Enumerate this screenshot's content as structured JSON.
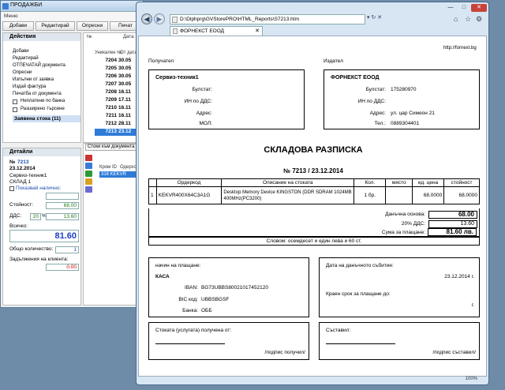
{
  "sales": {
    "title": "ПРОДАЖБИ",
    "menu": "Меню",
    "toolbar": [
      "Добави",
      "Редактирай",
      "Опресни",
      "Печат"
    ],
    "actions_header": "Действия",
    "actions": [
      "Добави",
      "Редактирай",
      "ОТПЕЧАТАЙ документа",
      "Опресни",
      "Изпълни от заявка",
      "Издай фактура",
      "Печатба от документа"
    ],
    "checkboxes": [
      "Неплатени по банка",
      "Разширено търсене"
    ],
    "selected_action": "Заявена стока (11)",
    "filter_labels": {
      "no": "№",
      "date": "Дата:"
    },
    "grid_headers": [
      "Уникален №",
      "От дата"
    ],
    "grid_rows": [
      {
        "id": "7204",
        "date": "30.05"
      },
      {
        "id": "7205",
        "date": "30.05"
      },
      {
        "id": "7206",
        "date": "30.05"
      },
      {
        "id": "7207",
        "date": "30.05"
      },
      {
        "id": "7208",
        "date": "16.11"
      },
      {
        "id": "7209",
        "date": "17.11"
      },
      {
        "id": "7210",
        "date": "16.11"
      },
      {
        "id": "7211",
        "date": "16.11"
      },
      {
        "id": "7212",
        "date": "28.11"
      },
      {
        "id": "7213",
        "date": "23.12"
      }
    ],
    "details_header": "Детайли",
    "details": {
      "no_label": "№",
      "no": "7213",
      "date": "23.12.2014",
      "client": "Сервиз-техник1",
      "warehouse": "СКЛАД 1",
      "cash_label": "Показвай налично:",
      "value_label": "Стойност:",
      "value": "68.00",
      "vat_label": "ДДС:",
      "vat_percent": "20",
      "vat_percent_sign": "%",
      "vat_value": "13.60",
      "total_label": "Всичко:",
      "total": "81.60",
      "qty_label": "Общо количество:",
      "qty": "1",
      "debt_label": "Задължения на клиента:",
      "debt": "0.00"
    },
    "items_tab": "Стоки към документа",
    "items_headers": [
      "Кром ID",
      "Одерхо"
    ],
    "items_row": "316  KEKVR"
  },
  "browser": {
    "address": "D:\\Dlphprg\\GVStorePRO\\HTML_Reports\\S7213.htm",
    "tab_title": "ФОРНЕКСТ ЕООД",
    "status_zoom": "100%",
    "nav_back": "◀",
    "nav_forward": "▶",
    "addr_tools": "▾ ↻ ✕",
    "tab_close": "✕",
    "caption_buttons": [
      "—",
      "□",
      "✕"
    ],
    "ie_icons": [
      "⌂",
      "☆",
      "⚙"
    ]
  },
  "doc": {
    "website": "http://fornext.bg",
    "recipient_caption": "Получател",
    "issuer_caption": "Издател",
    "recipient": {
      "name": "Сервиз-техник1",
      "bulstat_label": "Булстат:",
      "vat_label": "ИН по ДДС:",
      "address_label": "Адрес:",
      "mol_label": "МОЛ:"
    },
    "issuer": {
      "name": "ФОРНЕКСТ ЕООД",
      "bulstat_label": "Булстат:",
      "bulstat": "175280970",
      "vat_label": "ИН по ДДС:",
      "address_label": "Адрес:",
      "address": "ул. цар Симеон 21",
      "phone_label": "Тел.:",
      "phone": "0889304401"
    },
    "title": "СКЛАДОВА РАЗПИСКА",
    "number_line": "№ 7213 / 23.12.2014",
    "table_headers": [
      "Ордеркод",
      "Описание на стоката",
      "Кол.",
      "място",
      "ед. цена",
      "стойност"
    ],
    "table_row": {
      "no": "1",
      "code": "KEKVR400X64C3A1G",
      "description": "Desktop Memory Device KINGSTON (DDR SDRAM 1024MB 400MHz(PC3200)",
      "qty": "1 бр.",
      "place": "",
      "unit_price": "68.0000",
      "amount": "68.0000"
    },
    "tax_base_label": "Данъчна основа:",
    "tax_base": "68.00",
    "vat_label": "20% ДДС:",
    "vat": "13.60",
    "sum_label": "Сума за плащане:",
    "sum": "81.60 лв.",
    "words": "Словом: осемдесет и един лева и 60 ст.",
    "payment_label": "начин на плащане:",
    "payment": "КАСА",
    "iban_label": "IBAN:",
    "iban": "BG73UBBS80021017452120",
    "bic_label": "BIC код:",
    "bic": "UBBSBGSF",
    "bank_label": "Банка:",
    "bank": "ОББ",
    "tax_event_label": "Дата на данъчното събитие:",
    "tax_event_date": "23.12.2014 г.",
    "deadline_label": "Краен срок за плащане до:",
    "deadline_suffix": "г.",
    "received_label": "Стоката (услугата) получена от:",
    "received_sign": "/подпис получил/",
    "composed_label": "Съставил:",
    "composed_sign": "/подпис съставил/"
  }
}
